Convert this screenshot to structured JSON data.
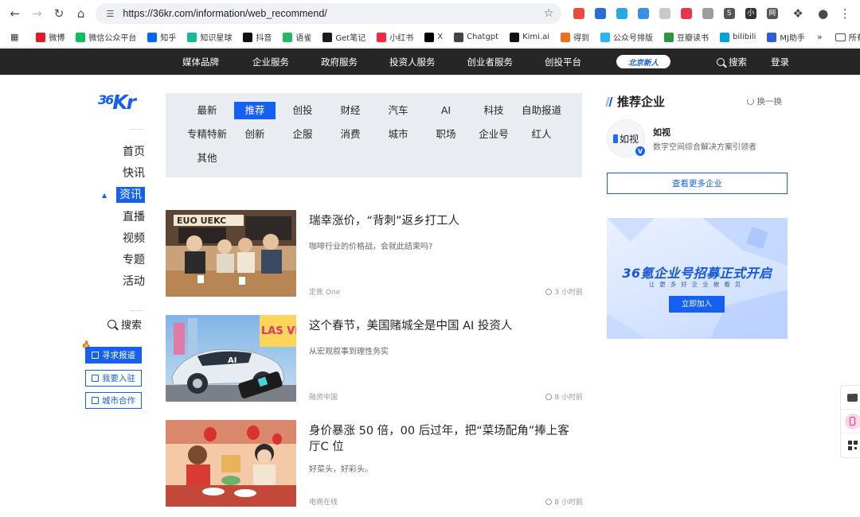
{
  "browser": {
    "url": "https://36kr.com/information/web_recommend/",
    "bookmarks": [
      {
        "label": "微博",
        "color": "#e6162d"
      },
      {
        "label": "微信公众平台",
        "color": "#07c160"
      },
      {
        "label": "知乎",
        "color": "#0066ff"
      },
      {
        "label": "知识星球",
        "color": "#16b998"
      },
      {
        "label": "抖音",
        "color": "#111111"
      },
      {
        "label": "语雀",
        "color": "#25b864"
      },
      {
        "label": "Get笔记",
        "color": "#1b1b1b"
      },
      {
        "label": "小红书",
        "color": "#ff2442"
      },
      {
        "label": "X",
        "color": "#000000"
      },
      {
        "label": "Chatgpt",
        "color": "#444444"
      },
      {
        "label": "Kimi.ai",
        "color": "#111111"
      },
      {
        "label": "得到",
        "color": "#f06f1c"
      },
      {
        "label": "公众号排版",
        "color": "#29b6f6"
      },
      {
        "label": "豆瓣读书",
        "color": "#2e963d"
      },
      {
        "label": "bilibili",
        "color": "#00a1d6"
      },
      {
        "label": "MJ助手",
        "color": "#2c5fd8"
      }
    ],
    "bookmark_folder": "所有书签",
    "extensions": [
      {
        "color": "#e94b3c",
        "glyph": ""
      },
      {
        "color": "#2b6bd8",
        "glyph": ""
      },
      {
        "color": "#2aa8e0",
        "glyph": ""
      },
      {
        "color": "#3a8ee6",
        "glyph": ""
      },
      {
        "color": "#c9c9c9",
        "glyph": ""
      },
      {
        "color": "#e8354b",
        "glyph": ""
      },
      {
        "color": "#9e9e9e",
        "glyph": ""
      },
      {
        "color": "#555555",
        "glyph": "S"
      },
      {
        "color": "#333333",
        "glyph": "小"
      },
      {
        "color": "#555555",
        "glyph": "网"
      }
    ]
  },
  "topnav": {
    "items": [
      "媒体品牌",
      "企业服务",
      "政府服务",
      "投资人服务",
      "创业者服务",
      "创投平台"
    ],
    "promo": "北京新人",
    "search": "搜索",
    "login": "登录"
  },
  "logo": {
    "text_big": "36",
    "text_kr": "Kr"
  },
  "leftnav": {
    "items": [
      "首页",
      "快讯",
      "资讯",
      "直播",
      "视频",
      "专题",
      "活动"
    ],
    "active_index": 2,
    "search": "搜索",
    "buttons": [
      "寻求报道",
      "我要入驻",
      "城市合作"
    ]
  },
  "categories": {
    "items": [
      "最新",
      "推荐",
      "创投",
      "财经",
      "汽车",
      "AI",
      "科技",
      "自助报道",
      "专精特新",
      "创新",
      "企服",
      "消费",
      "城市",
      "职场",
      "企业号",
      "红人",
      "其他"
    ],
    "active": "推荐"
  },
  "articles": [
    {
      "title": "瑞幸涨价，“背刺”返乡打工人",
      "desc": "咖啡行业的价格战，会就此结束吗?",
      "source": "定焦 One",
      "time": "3 小时前",
      "thumb_text": "EUO UEKC"
    },
    {
      "title": "这个春节，美国赌城全是中国 AI 投资人",
      "desc": "从宏观叙事到理性务实",
      "source": "融资中国",
      "time": "8 小时前",
      "thumb_text": "LAS VE"
    },
    {
      "title": "身价暴涨 50 倍，00 后过年，把“菜场配角”捧上客厅C 位",
      "desc": "好菜头，好彩头。",
      "source": "电商在线",
      "time": "8 小时前"
    }
  ],
  "recommend": {
    "title": "推荐企业",
    "swap": "换一换",
    "company_name": "如视",
    "company_logo_text": "如视",
    "company_desc": "数字空间综合解决方案引领者",
    "more": "查看更多企业",
    "banner_title": "36氪企业号招募正式开启",
    "banner_sub": "让更多好企业被看见",
    "banner_btn": "立即加入"
  }
}
